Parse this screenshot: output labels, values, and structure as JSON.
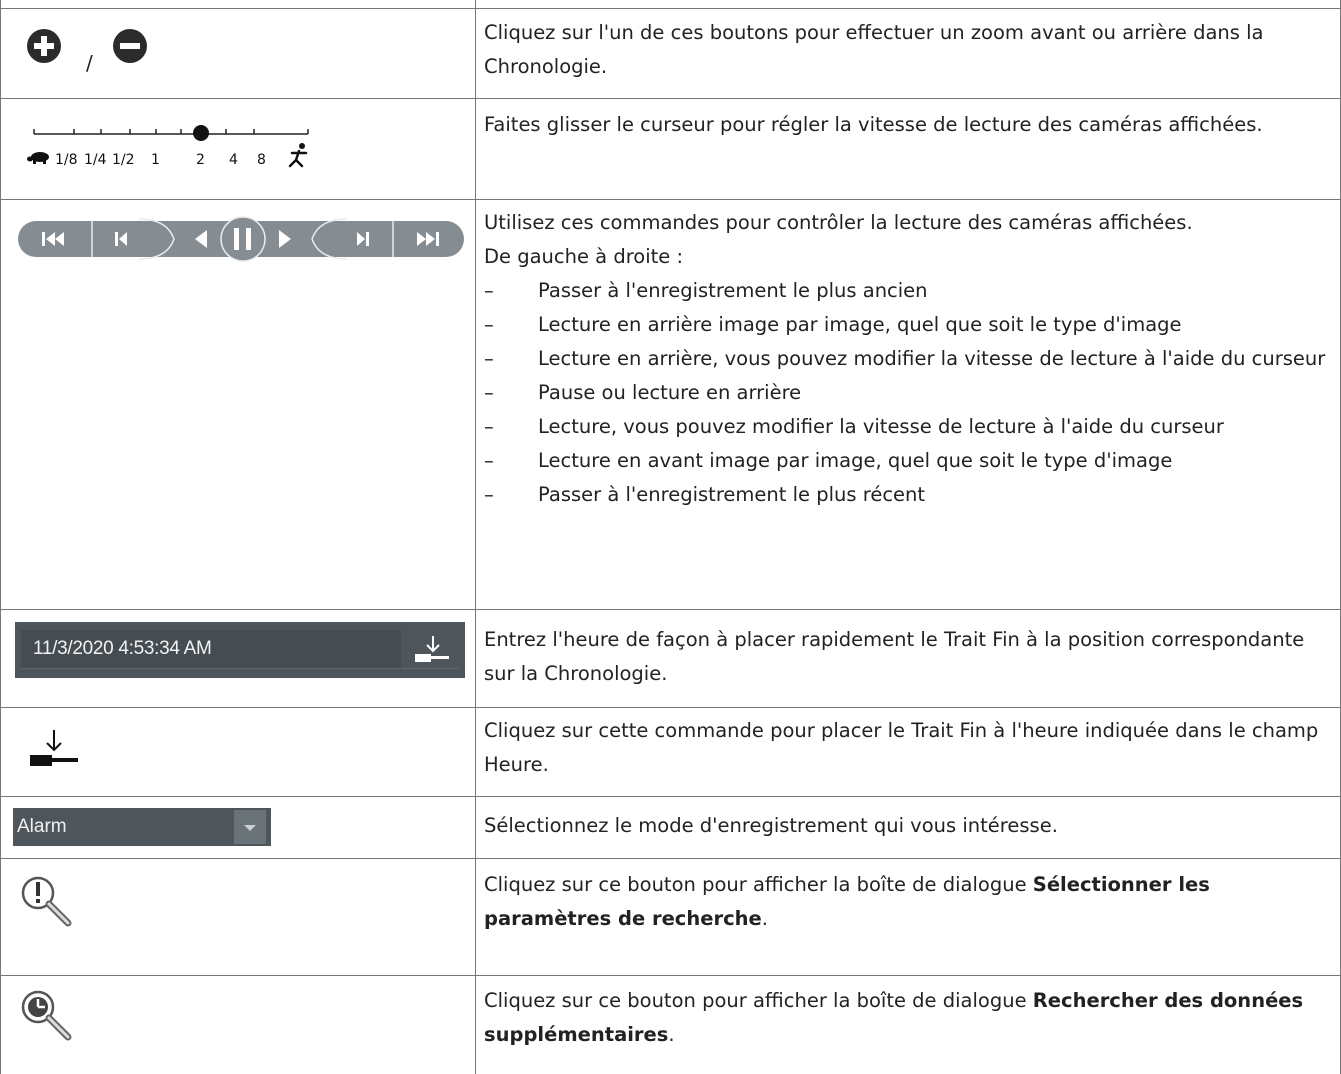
{
  "rows": [
    {
      "icon": "zoom-in-out-icons",
      "separator": "/",
      "text": "Cliquez sur l'un de ces boutons pour effectuer un zoom avant ou arrière dans la Chronologie."
    },
    {
      "icon": "speed-slider-icon",
      "slider": {
        "labels": [
          "1/8",
          "1/4",
          "1/2",
          "1",
          "2",
          "4",
          "8"
        ],
        "selected": "2",
        "left_icon": "turtle-icon",
        "right_icon": "running-man-icon"
      },
      "text": "Faites glisser le curseur pour régler la vitesse de lecture des caméras affichées."
    },
    {
      "icon": "playback-controls-icon",
      "text": "Utilisez ces commandes pour contrôler la lecture des caméras affichées.",
      "intro": "De gauche à droite :",
      "items": [
        "Passer à l'enregistrement le plus ancien",
        "Lecture en arrière image par image, quel que soit le type d'image",
        "Lecture en arrière, vous pouvez modifier la vitesse de lecture à l'aide du curseur",
        "Pause ou lecture en arrière",
        "Lecture, vous pouvez modifier la vitesse de lecture à l'aide du curseur",
        "Lecture en avant image par image, quel que soit le type d'image",
        "Passer à l'enregistrement le plus récent"
      ]
    },
    {
      "icon": "time-field-icon",
      "time_value": "11/3/2020 4:53:34 AM",
      "text": "Entrez l'heure de façon à placer rapidement le Trait Fin à la position correspondante sur la Chronologie."
    },
    {
      "icon": "set-hairline-icon",
      "text": "Cliquez sur cette commande pour placer le Trait Fin à l'heure indiquée dans le champ Heure."
    },
    {
      "icon": "recording-mode-dropdown",
      "dropdown_value": "Alarm",
      "text": "Sélectionnez le mode d'enregistrement qui vous intéresse."
    },
    {
      "icon": "search-parameters-icon",
      "text_before": "Cliquez sur ce bouton pour afficher la boîte de dialogue ",
      "text_bold": "Sélectionner les paramètres de recherche",
      "text_after": "."
    },
    {
      "icon": "search-extra-data-icon",
      "text_before": "Cliquez sur ce bouton pour afficher la boîte de dialogue ",
      "text_bold": "Rechercher des données supplémentaires",
      "text_after": "."
    }
  ],
  "dash": "–",
  "colors": {
    "border": "#777777",
    "text": "#222222",
    "control_dark": "#4a5258",
    "control_light": "#8c959b"
  }
}
